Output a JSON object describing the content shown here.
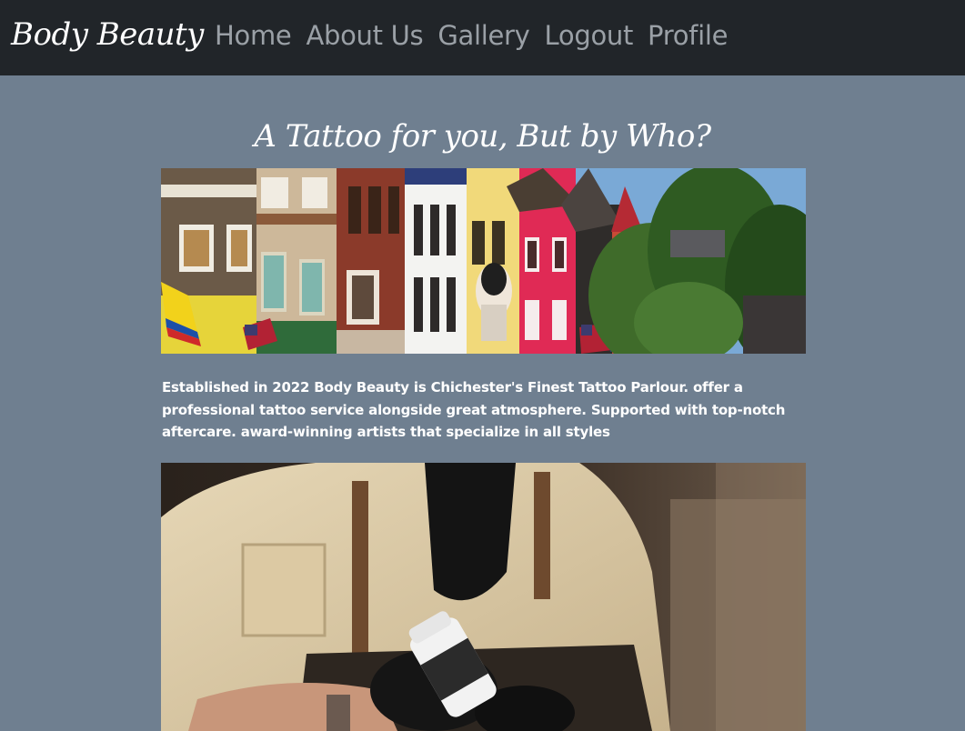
{
  "navbar": {
    "brand": "Body Beauty",
    "links": [
      {
        "label": "Home"
      },
      {
        "label": "About Us"
      },
      {
        "label": "Gallery"
      },
      {
        "label": "Logout"
      },
      {
        "label": "Profile"
      }
    ]
  },
  "main": {
    "headline": "A Tattoo for you, But by Who?",
    "intro": "Established in 2022 Body Beauty is Chichester's Finest Tattoo Parlour. offer a professional tattoo service alongside great atmosphere. Supported with top-notch aftercare. award-winning artists that specialize in all styles"
  },
  "colors": {
    "navbar_bg": "#212529",
    "page_bg": "#6f7f90",
    "nav_link": "#9aa0a6",
    "text": "#ffffff"
  }
}
